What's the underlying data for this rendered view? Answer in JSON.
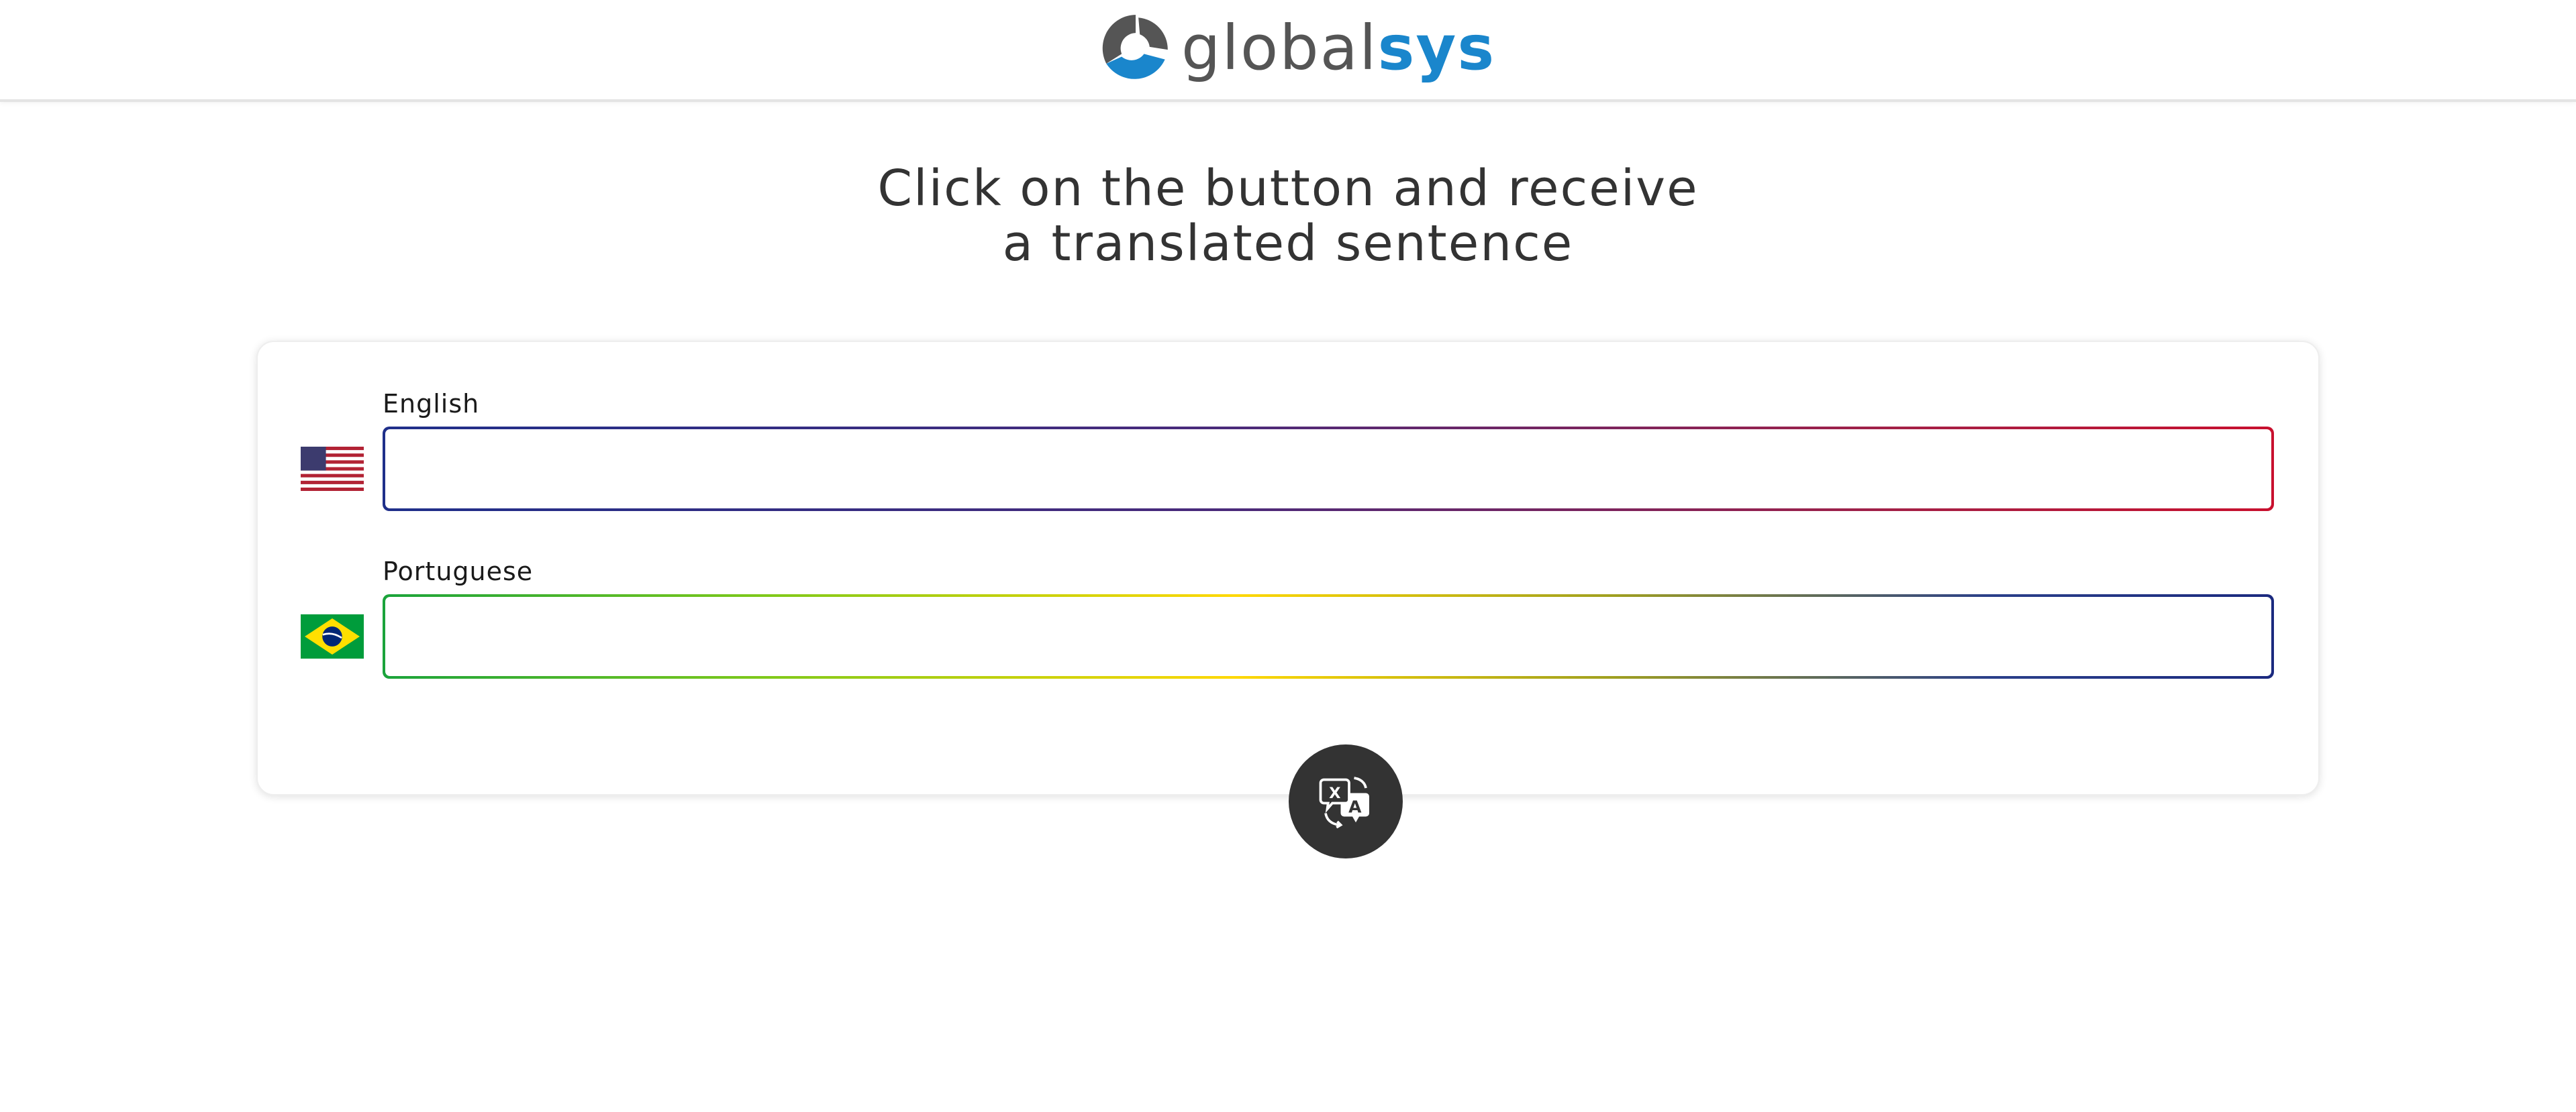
{
  "header": {
    "logo_icon": "globalsys-logo-mark",
    "logo_text_part1": "global",
    "logo_text_part2": "sys",
    "colors": {
      "part1": "#555555",
      "part2": "#1a86cc"
    }
  },
  "title": {
    "line1": "Click on the button and receive",
    "line2": "a translated sentence"
  },
  "fields": {
    "english": {
      "label": "English",
      "flag_icon": "us-flag-icon",
      "value": "",
      "placeholder": ""
    },
    "portuguese": {
      "label": "Portuguese",
      "flag_icon": "brazil-flag-icon",
      "value": "",
      "placeholder": ""
    }
  },
  "translate_button": {
    "icon": "translate-icon",
    "background": "#333333"
  }
}
